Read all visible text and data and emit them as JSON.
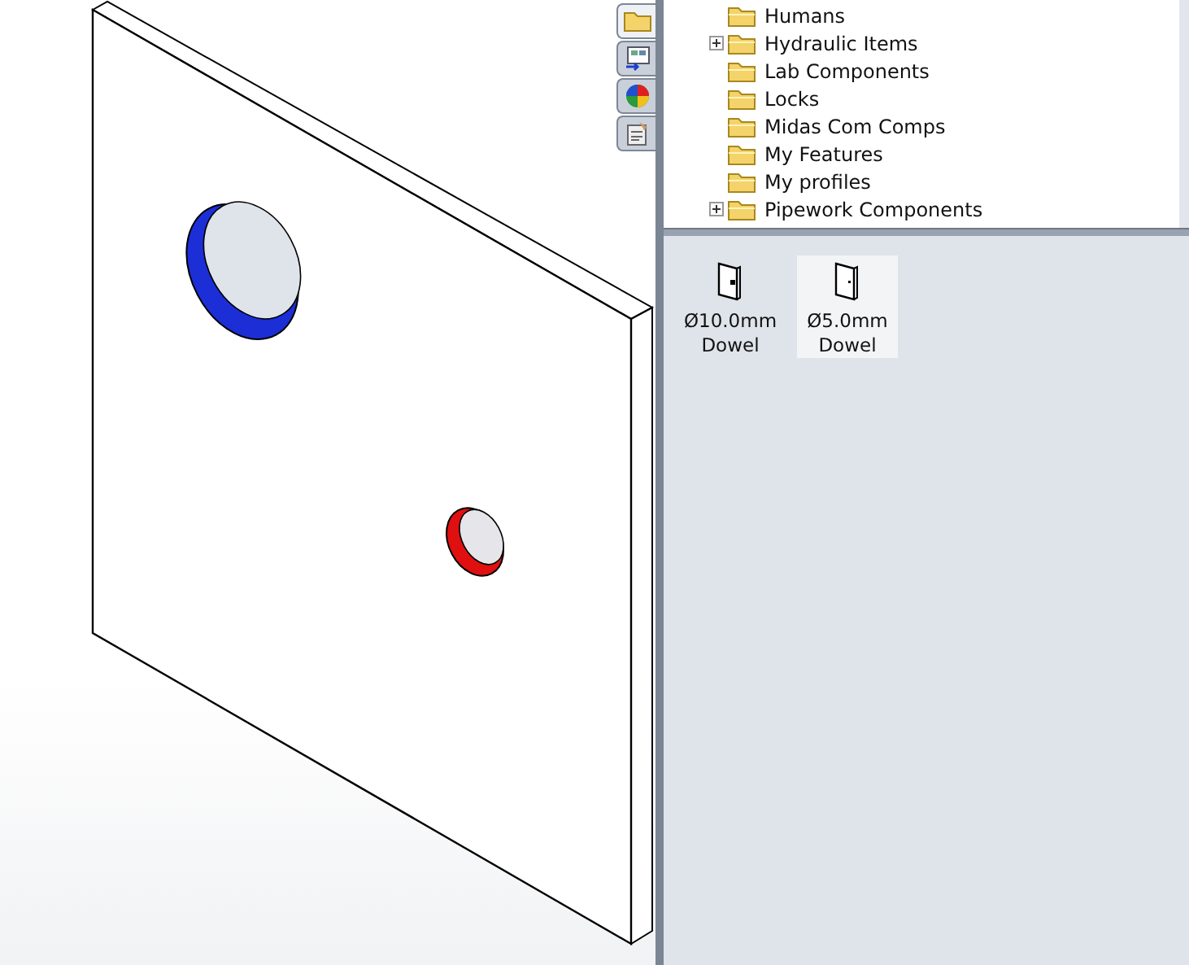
{
  "task_pane_tabs": [
    {
      "kind": "folder",
      "selected": true
    },
    {
      "kind": "library",
      "selected": false
    },
    {
      "kind": "appearance",
      "selected": false
    },
    {
      "kind": "properties",
      "selected": false
    }
  ],
  "library_tree": [
    {
      "label": "Humans",
      "expandable": false
    },
    {
      "label": "Hydraulic Items",
      "expandable": true
    },
    {
      "label": "Lab Components",
      "expandable": false
    },
    {
      "label": "Locks",
      "expandable": false
    },
    {
      "label": "Midas Com Comps",
      "expandable": false
    },
    {
      "label": "My Features",
      "expandable": false
    },
    {
      "label": "My profiles",
      "expandable": false
    },
    {
      "label": "Pipework Components",
      "expandable": true
    }
  ],
  "library_items": [
    {
      "label": "Ø10.0mm Dowel",
      "selected": false
    },
    {
      "label": "Ø5.0mm Dowel",
      "selected": true
    }
  ]
}
